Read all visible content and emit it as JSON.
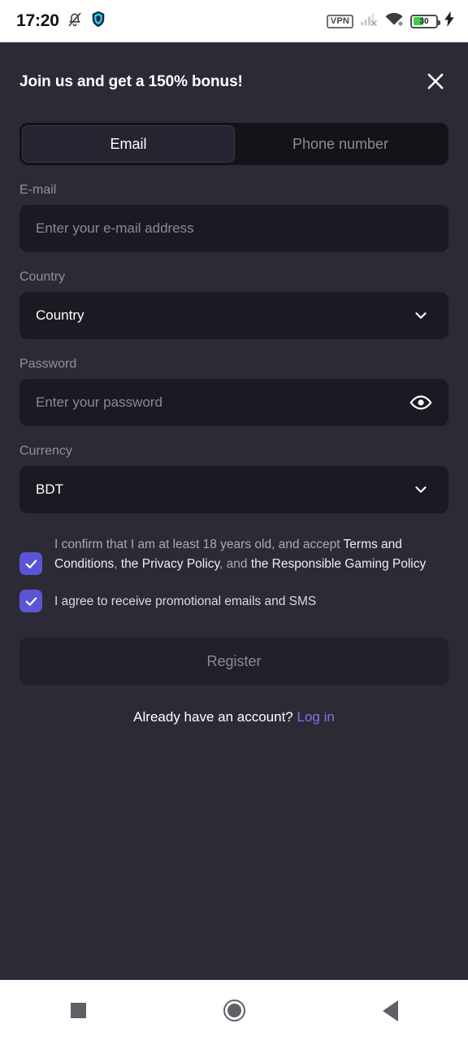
{
  "status_bar": {
    "time": "17:20",
    "icons_left": [
      "bell-muted-icon",
      "shield-icon"
    ],
    "vpn_label": "VPN",
    "icons_right": [
      "signal-off-icon",
      "wifi-icon"
    ],
    "battery_percent": "30",
    "battery_charging": true,
    "battery_color": "#3fcb48"
  },
  "modal": {
    "title": "Join us and get a 150% bonus!",
    "close_icon": "close-icon",
    "tabs": [
      {
        "label": "Email",
        "active": true
      },
      {
        "label": "Phone number",
        "active": false
      }
    ],
    "fields": {
      "email": {
        "label": "E-mail",
        "placeholder": "Enter your e-mail address",
        "value": ""
      },
      "country": {
        "label": "Country",
        "value": "Country",
        "icon": "chevron-down-icon"
      },
      "password": {
        "label": "Password",
        "placeholder": "Enter your password",
        "value": "",
        "icon": "eye-icon"
      },
      "currency": {
        "label": "Currency",
        "value": "BDT",
        "icon": "chevron-down-icon"
      }
    },
    "consents": [
      {
        "checked": true,
        "parts": [
          {
            "text": "I confirm that I am at least 18 years old, and accept ",
            "link": false
          },
          {
            "text": "Terms and Conditions",
            "link": true
          },
          {
            "text": ", ",
            "link": false
          },
          {
            "text": "the Privacy Policy",
            "link": true
          },
          {
            "text": ", and ",
            "link": false
          },
          {
            "text": "the Responsible Gaming Policy",
            "link": true
          }
        ]
      },
      {
        "checked": true,
        "text": "I agree to receive promotional emails and SMS"
      }
    ],
    "submit": {
      "label": "Register",
      "enabled": false
    },
    "login_prompt": "Already have an account?",
    "login_link": "Log in",
    "accent_color": "#5b55d6",
    "link_color": "#7b77e0"
  },
  "nav_bar": {
    "buttons": [
      {
        "name": "recents",
        "icon": "square-icon"
      },
      {
        "name": "home",
        "icon": "circle-icon"
      },
      {
        "name": "back",
        "icon": "triangle-left-icon"
      }
    ]
  }
}
